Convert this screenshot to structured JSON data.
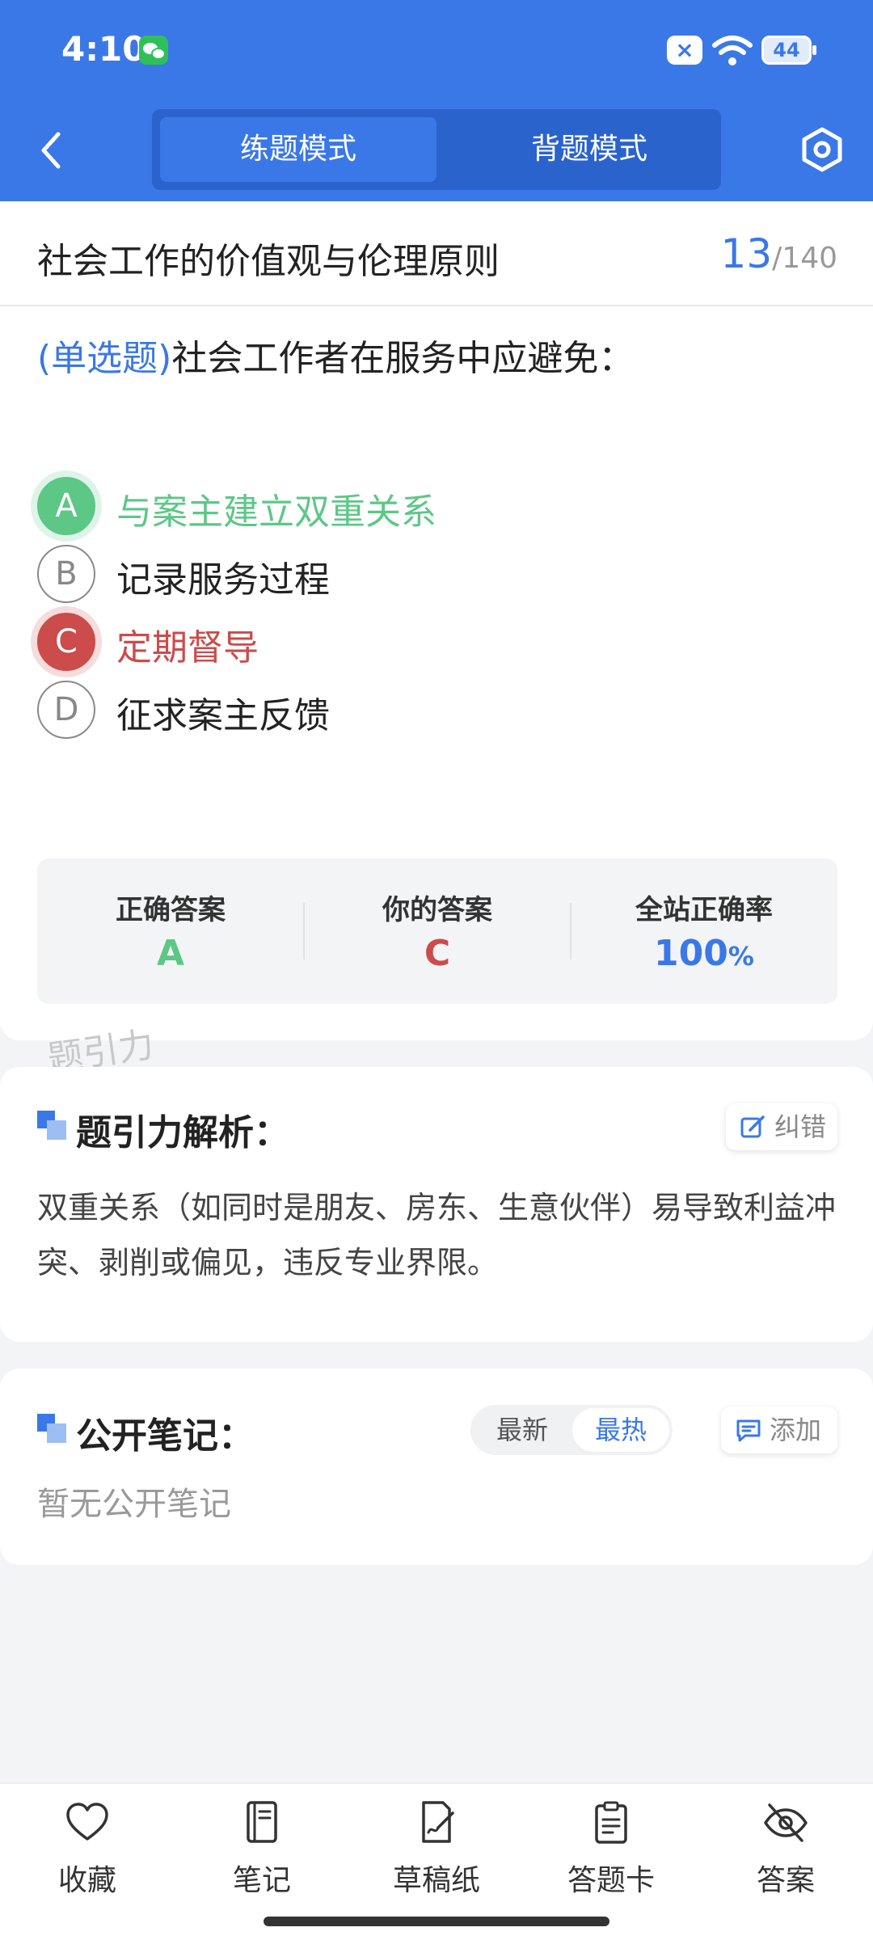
{
  "status_bar": {
    "time": "4:10",
    "battery": "44"
  },
  "header": {
    "modes": [
      "练题模式",
      "背题模式"
    ],
    "active_mode": "练题模式"
  },
  "question_card": {
    "chapter_title": "社会工作的价值观与伦理原则",
    "current": "13",
    "total": "/140",
    "question_type": "(单选题)",
    "question_text": "社会工作者在服务中应避免：",
    "options": [
      {
        "letter": "A",
        "text": "与案主建立双重关系",
        "state": "correct"
      },
      {
        "letter": "B",
        "text": "记录服务过程",
        "state": "normal"
      },
      {
        "letter": "C",
        "text": "定期督导",
        "state": "wrong"
      },
      {
        "letter": "D",
        "text": "征求案主反馈",
        "state": "normal"
      }
    ],
    "result": {
      "correct_label": "正确答案",
      "correct_value": "A",
      "yours_label": "你的答案",
      "yours_value": "C",
      "rate_label": "全站正确率",
      "rate_value": "100",
      "rate_unit": "%"
    },
    "watermark": "题引力"
  },
  "analysis": {
    "title": "题引力解析：",
    "correct_button": "纠错",
    "text": "双重关系（如同时是朋友、房东、生意伙伴）易导致利益冲突、剥削或偏见，违反专业界限。"
  },
  "notes": {
    "title": "公开笔记：",
    "sort_newest": "最新",
    "sort_hottest": "最热",
    "active_sort": "最热",
    "add_button": "添加",
    "empty_text": "暂无公开笔记"
  },
  "bottom_nav": [
    {
      "label": "收藏",
      "icon": "heart-icon"
    },
    {
      "label": "笔记",
      "icon": "notebook-icon"
    },
    {
      "label": "草稿纸",
      "icon": "draft-paper-icon"
    },
    {
      "label": "答题卡",
      "icon": "answer-sheet-icon"
    },
    {
      "label": "答案",
      "icon": "eye-off-icon"
    }
  ],
  "colors": {
    "brand_blue": "#3b78e7",
    "correct_green": "#5dc786",
    "wrong_red": "#cc4b4b"
  }
}
